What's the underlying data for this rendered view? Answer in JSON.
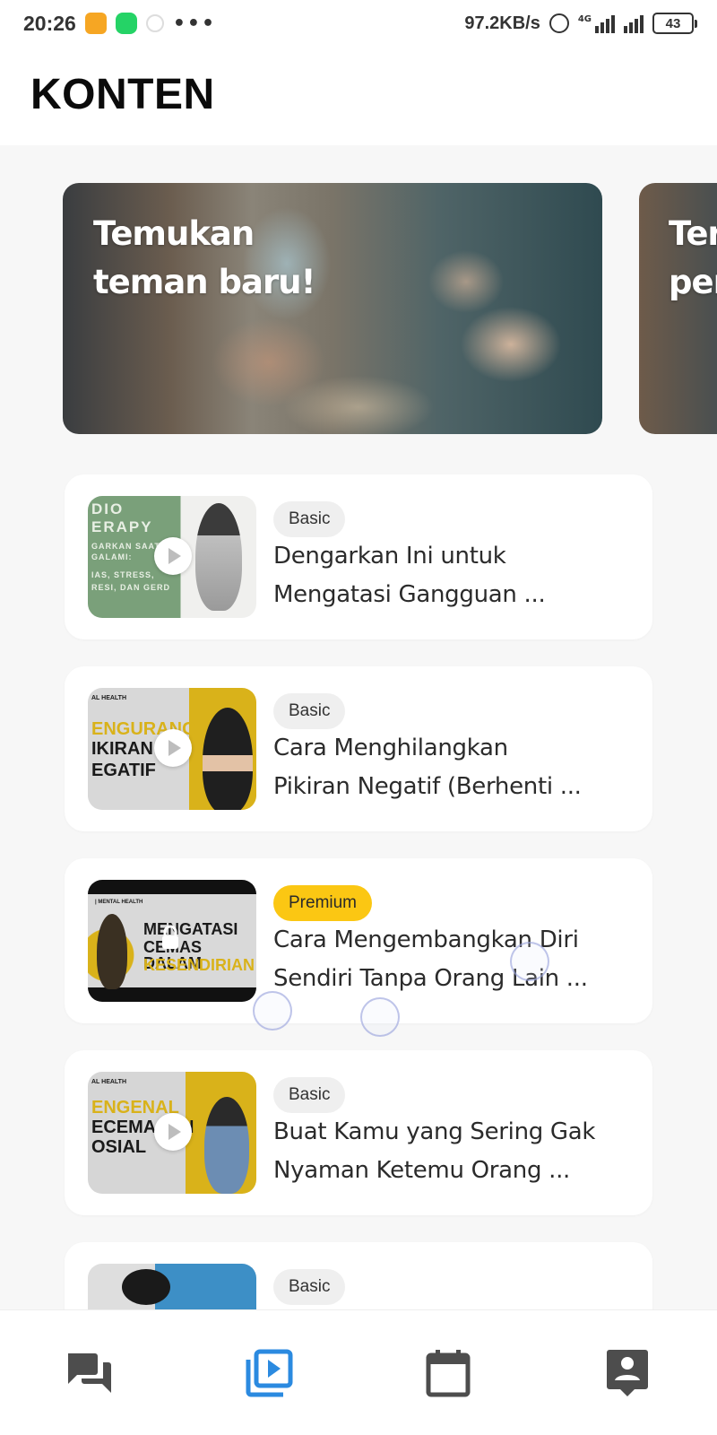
{
  "status_bar": {
    "time": "20:26",
    "network_speed": "97.2KB/s",
    "network_type": "4G",
    "battery": "43",
    "more": "•••"
  },
  "header": {
    "title": "KONTEN"
  },
  "banners": [
    {
      "title_line1": "Temukan",
      "title_line2": "teman baru!"
    },
    {
      "title_line1": "Ter",
      "title_line2": "per"
    }
  ],
  "content_list": [
    {
      "badge": "Basic",
      "title_line1": "Dengarkan Ini untuk",
      "title_line2": "Mengatasi Gangguan ...",
      "thumb_lines": [
        "DIO",
        "ERAPY",
        "GARKAN SAAT",
        "GALAMI:",
        "IAS, STRESS,",
        "RESI, DAN GERD"
      ]
    },
    {
      "badge": "Basic",
      "title_line1": "Cara Menghilangkan",
      "title_line2": "Pikiran Negatif (Berhenti ...",
      "thumb_lines": [
        "AL HEALTH",
        "ENGURANGI",
        "IKIRAN",
        "EGATIF"
      ]
    },
    {
      "badge": "Premium",
      "title_line1": "Cara Mengembangkan Diri",
      "title_line2": "Sendiri Tanpa Orang Lain ...",
      "thumb_lines": [
        "| MENTAL HEALTH",
        "MENGATASI",
        "CEMAS DALAM",
        "KESENDIRIAN"
      ]
    },
    {
      "badge": "Basic",
      "title_line1": "Buat Kamu yang Sering Gak",
      "title_line2": "Nyaman Ketemu Orang ...",
      "thumb_lines": [
        "AL HEALTH",
        "ENGENAL",
        "ECEMASAN",
        "OSIAL"
      ]
    },
    {
      "badge": "Basic",
      "title_line1": "",
      "title_line2": "",
      "thumb_lines": []
    }
  ],
  "bottom_nav": [
    {
      "icon": "forum-icon",
      "active": false
    },
    {
      "icon": "video-library-icon",
      "active": true
    },
    {
      "icon": "calendar-icon",
      "active": false
    },
    {
      "icon": "contact-icon",
      "active": false
    }
  ],
  "colors": {
    "premium_badge": "#fbc713",
    "basic_badge": "#efefef",
    "nav_active": "#2b8ae0",
    "nav_inactive": "#4d4d4d"
  }
}
